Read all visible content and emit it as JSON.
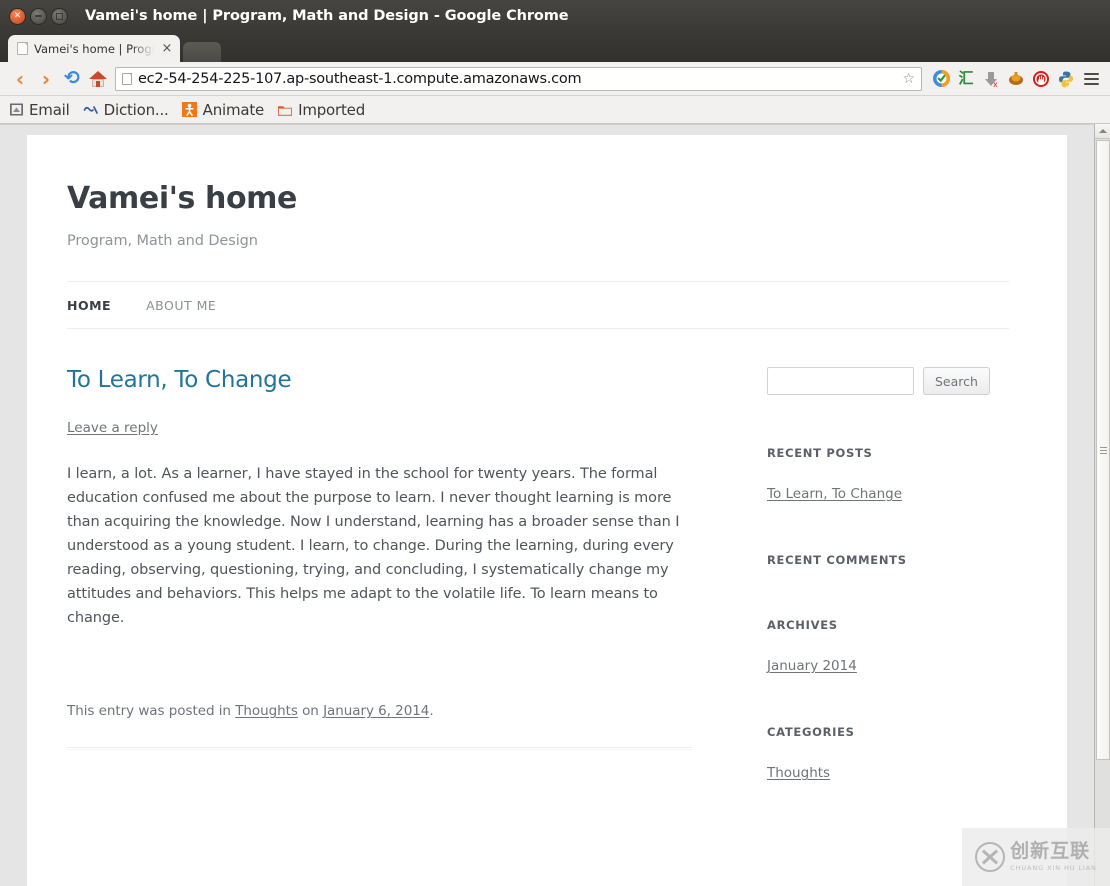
{
  "window": {
    "title": "Vamei's home | Program, Math and Design - Google Chrome",
    "controls": [
      {
        "name": "close",
        "glyph": "✕"
      },
      {
        "name": "minimize",
        "glyph": ""
      },
      {
        "name": "maximize",
        "glyph": ""
      }
    ]
  },
  "tab": {
    "title": "Vamei's home | Program,",
    "close_glyph": "×"
  },
  "toolbar": {
    "back_glyph": "‹",
    "forward_glyph": "›",
    "reload_glyph": "⟳",
    "home_icon": "home-icon",
    "url": "ec2-54-254-225-107.ap-southeast-1.compute.amazonaws.com",
    "star_glyph": "☆",
    "extensions": [
      {
        "name": "wot-shield-icon",
        "glyph": "✔"
      },
      {
        "name": "hui-dictionary-icon",
        "glyph": "汇"
      },
      {
        "name": "download-icon",
        "glyph": "⬇"
      },
      {
        "name": "evernote-icon",
        "glyph": "●"
      },
      {
        "name": "adblock-icon",
        "glyph": "✋"
      },
      {
        "name": "python-icon",
        "glyph": "●"
      }
    ],
    "menu_glyph": "≡"
  },
  "bookmarks": [
    {
      "label": "Email",
      "icon": "mail-icon"
    },
    {
      "label": "Diction...",
      "icon": "dictionary-icon"
    },
    {
      "label": "Animate",
      "icon": "animate-icon"
    },
    {
      "label": "Imported",
      "icon": "folder-icon"
    }
  ],
  "site": {
    "title": "Vamei's home",
    "description": "Program, Math and Design",
    "nav": [
      {
        "label": "HOME",
        "active": true
      },
      {
        "label": "ABOUT ME",
        "active": false
      }
    ]
  },
  "post": {
    "title": "To Learn, To Change",
    "leave_reply": "Leave a reply",
    "body": "I learn, a lot. As a learner, I have stayed in the school for twenty years. The formal education confused me about the purpose to learn. I never thought learning is more than acquiring the knowledge. Now I understand, learning has a broader sense than I understood as a young student. I learn, to change. During the learning, during every reading, observing, questioning, trying, and concluding, I systematically change my attitudes and behaviors. This helps me adapt to the volatile life. To learn means to change.",
    "meta_prefix": "This entry was posted in ",
    "meta_category": "Thoughts",
    "meta_mid": " on ",
    "meta_date": "January 6, 2014",
    "meta_suffix": "."
  },
  "sidebar": {
    "search": {
      "value": "",
      "placeholder": "",
      "button_label": "Search"
    },
    "widgets": [
      {
        "title": "RECENT POSTS",
        "links": [
          "To Learn, To Change"
        ]
      },
      {
        "title": "RECENT COMMENTS",
        "links": []
      },
      {
        "title": "ARCHIVES",
        "links": [
          "January 2014"
        ]
      },
      {
        "title": "CATEGORIES",
        "links": [
          "Thoughts"
        ]
      }
    ]
  },
  "watermark": {
    "chinese": "创新互联",
    "pinyin": "CHUANG XIN HU LIAN"
  },
  "colors": {
    "link": "#21759b",
    "body_text": "#50555b",
    "page_bg": "#e5e5e5",
    "card_bg": "#ffffff",
    "titlebar": "#3b3935"
  }
}
